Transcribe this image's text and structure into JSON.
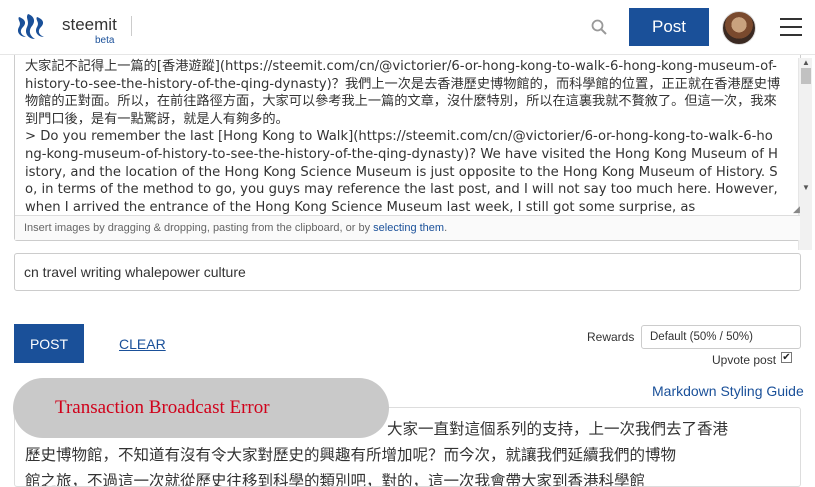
{
  "header": {
    "brand": "steemit",
    "beta": "beta",
    "post_label": "Post"
  },
  "editor": {
    "lines": [
      "大家記不記得上一篇的[香港遊蹤](https://steemit.com/cn/@victorier/6-or-hong-kong-to-walk-6-hong-kong-museum-of-history-to-see-the-history-of-the-qing-dynasty)？我們上一次是去香港歷史博物館的，而科學館的位置，正正就在香港歷史博物館的正對面。所以，在前往路徑方面，大家可以參考我上一篇的文章，沒什麼特別，所以在這裏我就不贅敘了。但這一次，我來到門口後，是有一點驚訝，就是人有夠多的。",
      "> Do you remember the last [Hong Kong to Walk](https://steemit.com/cn/@victorier/6-or-hong-kong-to-walk-6-hong-kong-museum-of-history-to-see-the-history-of-the-qing-dynasty)? We have visited the Hong Kong Museum of History, and the location of the Hong Kong Science Museum is just opposite to the Hong Kong Museum of History. So, in terms of the method to go, you guys may reference the last post, and I will not say too much here. However, when I arrived the entrance of the Hong Kong Science Museum last week, I still got some surprise, as"
    ],
    "hint_prefix": "Insert images by dragging & dropping, pasting from the clipboard, or by ",
    "hint_link": "selecting them",
    "hint_suffix": "."
  },
  "tags": {
    "value": "cn travel writing whalepower culture"
  },
  "actions": {
    "post": "POST",
    "clear": "CLEAR",
    "rewards_label": "Rewards",
    "rewards_value": "Default (50% / 50%)",
    "upvote_label": "Upvote post",
    "upvote_checked": "✔",
    "markdown_guide": "Markdown Styling Guide"
  },
  "preview": {
    "lines": [
      "大家一直對這個系列的支持，上一次我們去了香港",
      "歷史博物館，不知道有沒有令大家對歷史的興趣有所增加呢？而今次，就讓我們延續我們的博物",
      "館之旅，不過這一次就從歷史往移到科學的類別吧，對的，這一次我會帶大家到香港科學館"
    ]
  },
  "toast": {
    "message": "Transaction Broadcast Error"
  },
  "colors": {
    "primary": "#1a5099",
    "error": "#d0021b",
    "toast_bg": "#c9c9c9"
  }
}
